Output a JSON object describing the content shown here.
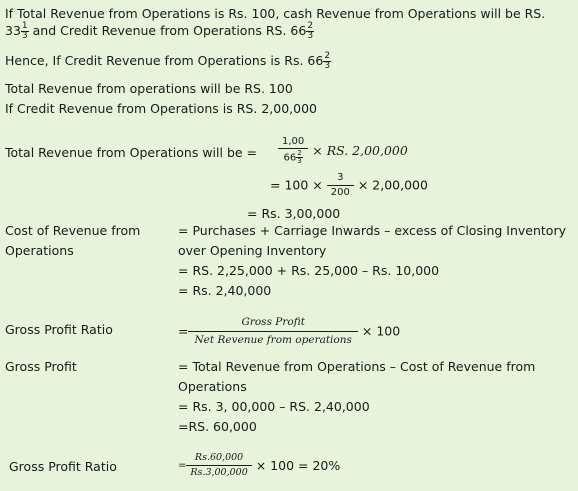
{
  "intro": {
    "line1": "If Total Revenue from Operations is Rs. 100, cash Revenue from Operations will be RS.",
    "cash_whole": "33",
    "cash_num": "1",
    "cash_den": "3",
    "credit_text": " and Credit Revenue from Operations RS. 66",
    "credit_num": "2",
    "credit_den": "3",
    "hence_text": "Hence, If Credit Revenue from Operations is Rs. 66",
    "hence_num": "2",
    "hence_den": "3",
    "total_line": "Total Revenue from operations will be RS. 100",
    "if_credit_line": "If Credit Revenue from Operations is RS. 2,00,000"
  },
  "total_rev": {
    "label": "Total Revenue from Operations will be =",
    "frac_num": "1,00",
    "frac_den_whole": "66",
    "frac_den_num": "2",
    "frac_den_den": "3",
    "times_rs": "× RS. 2,00,000",
    "step2_pre": "= 100 ×",
    "step2_num": "3",
    "step2_den": "200",
    "step2_post": "× 2,00,000",
    "result": "= Rs. 3,00,000"
  },
  "cost": {
    "label_line1": "Cost of Revenue from",
    "label_line2": "Operations",
    "line1": "= Purchases + Carriage Inwards – excess of Closing Inventory",
    "line2": "over Opening Inventory",
    "line3": "= RS. 2,25,000 + Rs. 25,000 – Rs. 10,000",
    "line4": "= Rs. 2,40,000"
  },
  "gp_ratio_formula": {
    "label": "Gross Profit Ratio",
    "eq": "=",
    "num": "Gross Profit",
    "den": "Net Revenue from operations",
    "times": "× 100"
  },
  "gross_profit": {
    "label": "Gross Profit",
    "line1": "= Total Revenue from Operations – Cost of Revenue from",
    "line2": "Operations",
    "line3": "= Rs. 3, 00,000 – RS. 2,40,000",
    "line4": "=RS. 60,000"
  },
  "gp_ratio_result": {
    "label": "Gross Profit Ratio",
    "eq": "=",
    "num": "Rs.60,000",
    "den": "Rs.3,00,000",
    "result": "× 100 = 20%"
  }
}
